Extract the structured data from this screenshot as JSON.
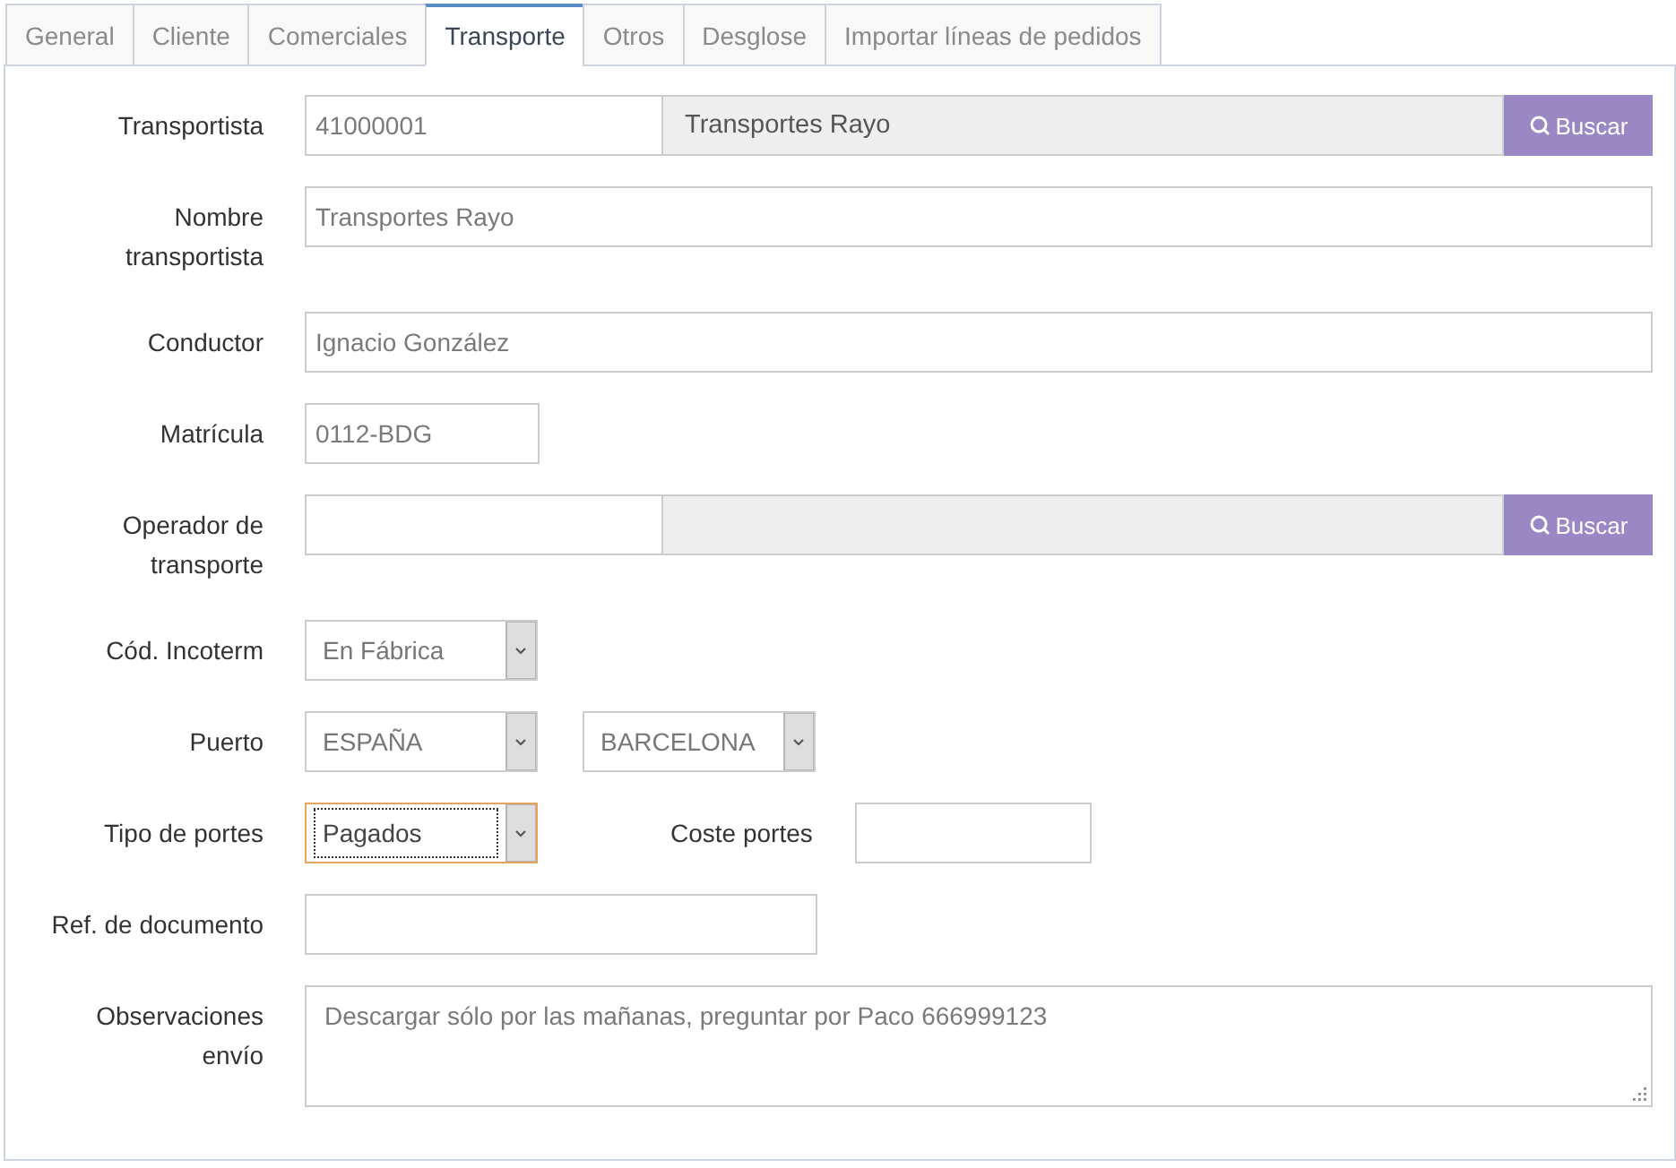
{
  "tabs": [
    {
      "label": "General",
      "selected": false
    },
    {
      "label": "Cliente",
      "selected": false
    },
    {
      "label": "Comerciales",
      "selected": false
    },
    {
      "label": "Transporte",
      "selected": true
    },
    {
      "label": "Otros",
      "selected": false
    },
    {
      "label": "Desglose",
      "selected": false
    },
    {
      "label": "Importar líneas de pedidos",
      "selected": false
    }
  ],
  "form": {
    "rows": [
      {
        "kind": "lookup",
        "label": "Transportista",
        "code": "41000001",
        "name": "Transportes Rayo",
        "button": "Buscar"
      },
      {
        "kind": "text",
        "label": "Nombre transportista",
        "value": "Transportes Rayo"
      },
      {
        "kind": "text",
        "label": "Conductor",
        "value": "Ignacio González"
      },
      {
        "kind": "short-text",
        "label": "Matrícula",
        "value": "0112-BDG"
      },
      {
        "kind": "lookup",
        "label": "Operador de transporte",
        "button": "Buscar"
      },
      {
        "kind": "select",
        "label": "Cód. Incoterm",
        "selects": [
          {
            "value": "En Fábrica",
            "focused": false
          }
        ]
      },
      {
        "kind": "select",
        "label": "Puerto",
        "selects": [
          {
            "value": "ESPAÑA",
            "focused": false
          },
          {
            "value": "BARCELONA",
            "focused": false
          }
        ]
      },
      {
        "kind": "select-cost",
        "label": "Tipo de portes",
        "selects": [
          {
            "value": "Pagados",
            "focused": true
          }
        ],
        "cost_label": "Coste portes"
      },
      {
        "kind": "medium-text",
        "label": "Ref. de documento"
      },
      {
        "kind": "textarea",
        "label": "Observaciones envío",
        "value": "Descargar sólo por las mañanas, preguntar por Paco 666999123"
      }
    ]
  }
}
